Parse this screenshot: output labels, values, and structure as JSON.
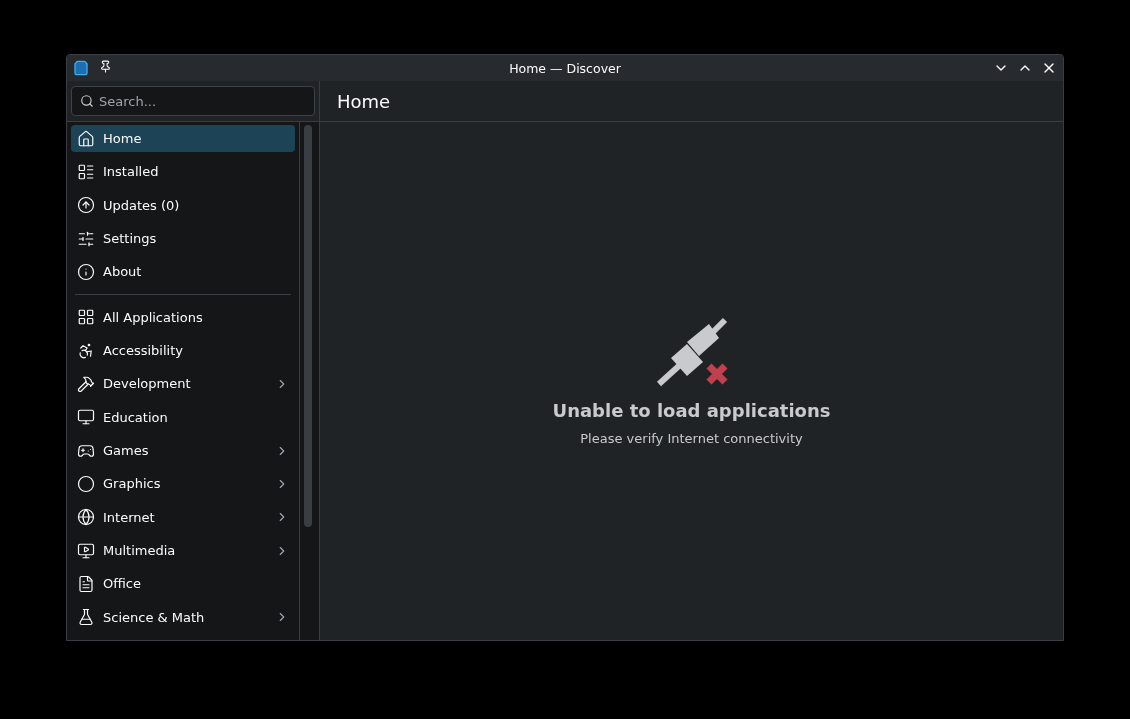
{
  "window": {
    "title": "Home — Discover"
  },
  "search": {
    "placeholder": "Search..."
  },
  "page_title": "Home",
  "nav_items": [
    {
      "label": "Home",
      "selected": true
    },
    {
      "label": "Installed",
      "selected": false
    },
    {
      "label": "Updates (0)",
      "selected": false
    },
    {
      "label": "Settings",
      "selected": false
    },
    {
      "label": "About",
      "selected": false
    }
  ],
  "categories": [
    {
      "label": "All Applications",
      "selected": false,
      "expandable": false
    },
    {
      "label": "Accessibility",
      "selected": false,
      "expandable": false
    },
    {
      "label": "Development",
      "selected": false,
      "expandable": true
    },
    {
      "label": "Education",
      "selected": false,
      "expandable": false
    },
    {
      "label": "Games",
      "selected": false,
      "expandable": true
    },
    {
      "label": "Graphics",
      "selected": false,
      "expandable": true
    },
    {
      "label": "Internet",
      "selected": false,
      "expandable": true
    },
    {
      "label": "Multimedia",
      "selected": false,
      "expandable": true
    },
    {
      "label": "Office",
      "selected": false,
      "expandable": false
    },
    {
      "label": "Science & Math",
      "selected": false,
      "expandable": true
    }
  ],
  "message": {
    "title": "Unable to load applications",
    "subtitle": "Please verify Internet connectivity"
  }
}
